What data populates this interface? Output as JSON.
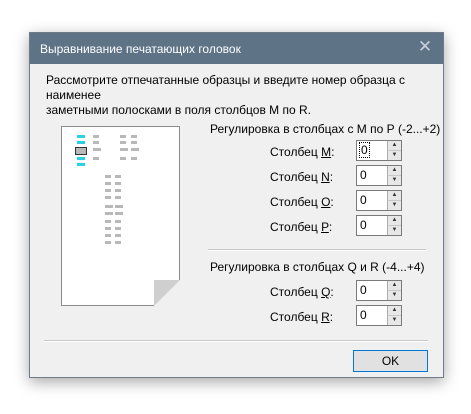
{
  "window": {
    "title": "Выравнивание печатающих головок",
    "close_glyph": "✕"
  },
  "description": {
    "line1": "Рассмотрите отпечатанные образцы и введите номер образца с наименее",
    "line2": "заметными полосками в поля столбцов М по R."
  },
  "group1": {
    "label": "Регулировка в столбцах с М по Р (-2...+2)",
    "rows": [
      {
        "prefix": "Столбец ",
        "letter": "М",
        "suffix": ":",
        "value": "0"
      },
      {
        "prefix": "Столбец ",
        "letter": "N",
        "suffix": ":",
        "value": "0"
      },
      {
        "prefix": "Столбец ",
        "letter": "О",
        "suffix": ":",
        "value": "0"
      },
      {
        "prefix": "Столбец ",
        "letter": "Р",
        "suffix": ":",
        "value": "0"
      }
    ]
  },
  "group2": {
    "label": "Регулировка в столбцах Q и R (-4...+4)",
    "rows": [
      {
        "prefix": "Столбец ",
        "letter": "Q",
        "suffix": ":",
        "value": "0"
      },
      {
        "prefix": "Столбец ",
        "letter": "R",
        "suffix": ":",
        "value": "0"
      }
    ]
  },
  "spinner": {
    "up_glyph": "▲",
    "down_glyph": "▼"
  },
  "buttons": {
    "ok_label": "OK"
  },
  "colors": {
    "titlebar": "#5f7387",
    "pattern_highlight": "#29d0e6",
    "ok_border": "#0078d7"
  }
}
